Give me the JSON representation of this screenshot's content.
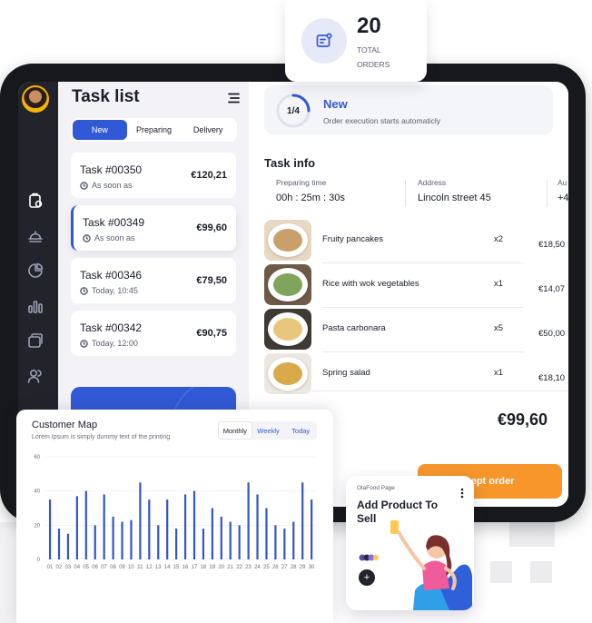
{
  "orders_card": {
    "count": "20",
    "label": "TOTAL ORDERS",
    "icon": "receipt-icon"
  },
  "sidebar": {
    "items": [
      {
        "name": "orders",
        "icon": "clipboard-icon",
        "active": true
      },
      {
        "name": "dishes",
        "icon": "cloche-icon",
        "active": false
      },
      {
        "name": "analytics",
        "icon": "pie-chart-icon",
        "active": false
      },
      {
        "name": "stats",
        "icon": "bar-chart-icon",
        "active": false
      },
      {
        "name": "cards",
        "icon": "wallet-icon",
        "active": false
      },
      {
        "name": "users",
        "icon": "users-icon",
        "active": false
      }
    ]
  },
  "task_list": {
    "title": "Task list",
    "tabs": [
      {
        "label": "New",
        "active": true
      },
      {
        "label": "Preparing",
        "active": false
      },
      {
        "label": "Delivery",
        "active": false
      }
    ],
    "orders": [
      {
        "name": "Task #00350",
        "time": "As soon as",
        "price": "€120,21",
        "selected": false
      },
      {
        "name": "Task #00349",
        "time": "As soon as",
        "price": "€99,60",
        "selected": true
      },
      {
        "name": "Task #00346",
        "time": "Today, 10:45",
        "price": "€79,50",
        "selected": false
      },
      {
        "name": "Task #00342",
        "time": "Today, 12:00",
        "price": "€90,75",
        "selected": false
      }
    ]
  },
  "status": {
    "progress_label": "1/4",
    "progress_fraction": 0.25,
    "title": "New",
    "subtitle": "Order execution starts automaticly"
  },
  "task_info": {
    "title": "Task info",
    "fields": [
      {
        "label": "Preparing time",
        "value": "00h : 25m : 30s"
      },
      {
        "label": "Address",
        "value": "Lincoln street 45"
      },
      {
        "label": "Au",
        "value": "+4"
      }
    ],
    "items": [
      {
        "name": "Fruity pancakes",
        "qty": "x2",
        "price": "€18,50",
        "color": "#c9a06a"
      },
      {
        "name": "Rice with wok vegetables",
        "qty": "x1",
        "price": "€14,07",
        "color": "#7fa45c"
      },
      {
        "name": "Pasta carbonara",
        "qty": "x5",
        "price": "€50,00",
        "color": "#e8c77c"
      },
      {
        "name": "Spring salad",
        "qty": "x1",
        "price": "€18,10",
        "color": "#d9a94a"
      }
    ],
    "total": "€99,60",
    "accept_label": "cept order"
  },
  "customer_map": {
    "title": "Customer Map",
    "subtitle": "Lorem Ipsum is simply dummy text of the printing",
    "tabs": [
      {
        "label": "Monthly",
        "active": true
      },
      {
        "label": "Weekly",
        "active": false
      },
      {
        "label": "Today",
        "active": false
      }
    ]
  },
  "chart_data": {
    "type": "bar",
    "categories": [
      "01",
      "02",
      "03",
      "04",
      "05",
      "06",
      "07",
      "08",
      "09",
      "10",
      "11",
      "12",
      "13",
      "14",
      "15",
      "16",
      "17",
      "18",
      "19",
      "20",
      "21",
      "22",
      "23",
      "24",
      "25",
      "26",
      "27",
      "28",
      "29",
      "30"
    ],
    "values": [
      35,
      18,
      15,
      37,
      40,
      20,
      38,
      25,
      22,
      23,
      45,
      35,
      20,
      35,
      18,
      38,
      40,
      18,
      30,
      25,
      22,
      20,
      45,
      38,
      30,
      20,
      18,
      22,
      45,
      35
    ],
    "yticks": [
      "0",
      "20",
      "40",
      "60"
    ],
    "ylim": [
      0,
      60
    ],
    "bar_color": "#3454c9",
    "xlabel": "",
    "ylabel": ""
  },
  "product_card": {
    "sup": "OlaFood Page",
    "title": "Add Product To Sell",
    "plus": "+"
  },
  "colors": {
    "accent": "#3159d6",
    "orange": "#f6962b",
    "dark": "#22232b"
  }
}
